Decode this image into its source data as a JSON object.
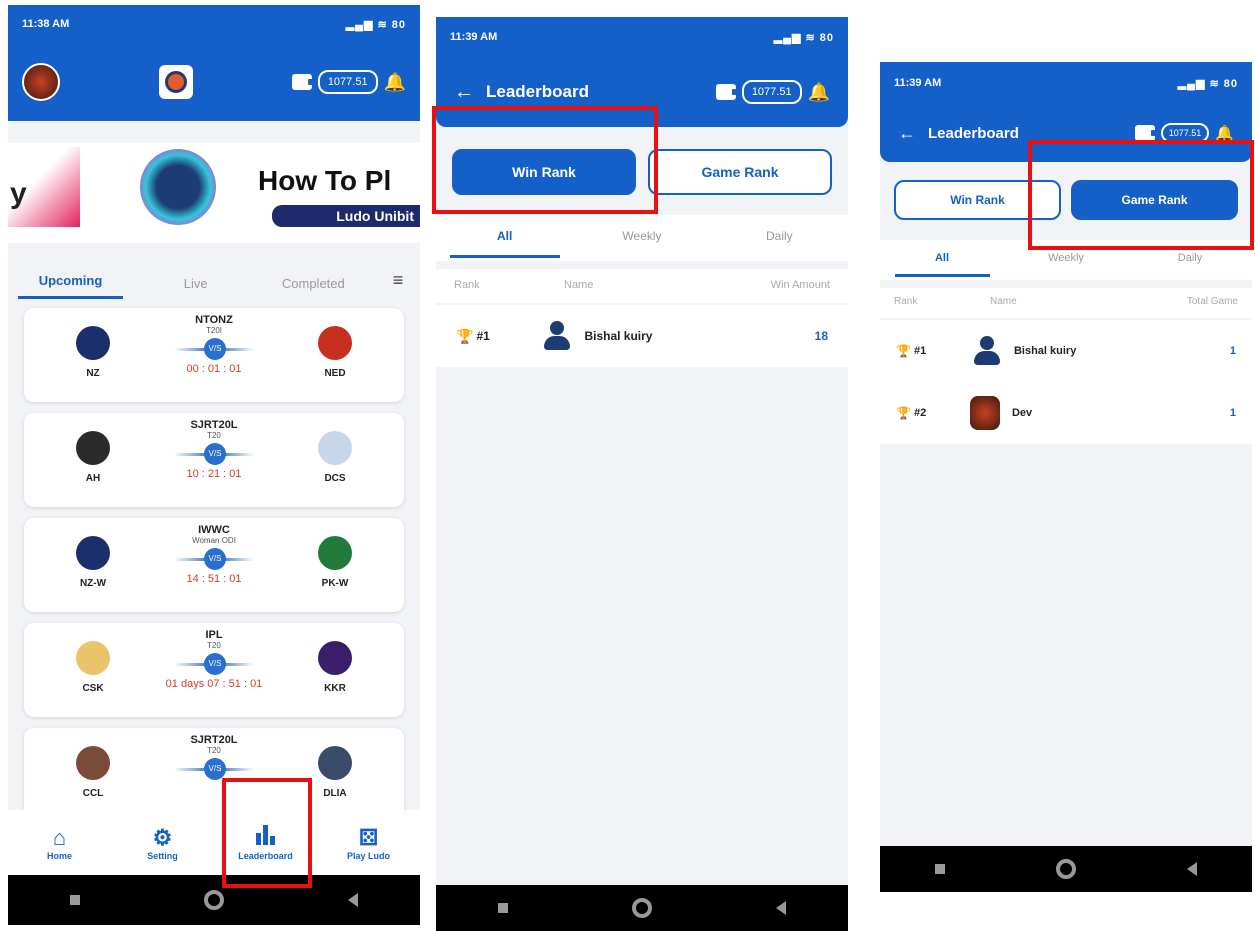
{
  "screen1": {
    "status": {
      "time": "11:38 AM",
      "icons": "▂▄▆ ≋ 80"
    },
    "balance": "1077.51",
    "banner": {
      "title": "How To Pl",
      "subtitle": "Ludo Unibit",
      "left_text": "y"
    },
    "tabs": [
      "Upcoming",
      "Live",
      "Completed"
    ],
    "matches": [
      {
        "league": "NTONZ",
        "type": "T20I",
        "team1": "NZ",
        "team2": "NED",
        "timer": "00 : 01 : 01",
        "c1": "#1a2f6b",
        "c2": "#c7301f"
      },
      {
        "league": "SJRT20L",
        "type": "T20",
        "team1": "AH",
        "team2": "DCS",
        "timer": "10 : 21 : 01",
        "c1": "#2b2b2b",
        "c2": "#c8d6ea"
      },
      {
        "league": "IWWC",
        "type": "Woman ODI",
        "team1": "NZ-W",
        "team2": "PK-W",
        "timer": "14 : 51 : 01",
        "c1": "#1a2f6b",
        "c2": "#1f7a3b"
      },
      {
        "league": "IPL",
        "type": "T20",
        "team1": "CSK",
        "team2": "KKR",
        "timer": "01 days 07 : 51 : 01",
        "c1": "#e9c46a",
        "c2": "#3b1e6b"
      },
      {
        "league": "SJRT20L",
        "type": "T20",
        "team1": "CCL",
        "team2": "DLIA",
        "timer": "",
        "c1": "#7a4a3a",
        "c2": "#3a4a6a"
      }
    ],
    "vs": "V/S",
    "bottom_nav": [
      "Home",
      "Setting",
      "Leaderboard",
      "Play Ludo"
    ]
  },
  "screen2": {
    "status": {
      "time": "11:39 AM",
      "icons": "▂▄▆ ≋ 80"
    },
    "title": "Leaderboard",
    "balance": "1077.51",
    "buttons": [
      "Win Rank",
      "Game Rank"
    ],
    "tabs": [
      "All",
      "Weekly",
      "Daily"
    ],
    "headers": [
      "Rank",
      "Name",
      "Win Amount"
    ],
    "rows": [
      {
        "rank": "#1",
        "name": "Bishal kuiry",
        "value": "18"
      }
    ]
  },
  "screen3": {
    "status": {
      "time": "11:39 AM",
      "icons": "▂▄▆ ≋ 80"
    },
    "title": "Leaderboard",
    "balance": "1077.51",
    "buttons": [
      "Win Rank",
      "Game Rank"
    ],
    "tabs": [
      "All",
      "Weekly",
      "Daily"
    ],
    "headers": [
      "Rank",
      "Name",
      "Total Game"
    ],
    "rows": [
      {
        "rank": "#1",
        "name": "Bishal kuiry",
        "value": "1"
      },
      {
        "rank": "#2",
        "name": "Dev",
        "value": "1"
      }
    ]
  },
  "icons": {
    "trophy": "🏆",
    "bell": "🔔",
    "back": "←",
    "filter": "≡",
    "home": "⌂",
    "gear": "⚙",
    "bars": "▮",
    "dice": "⚄"
  },
  "colors": {
    "primary": "#1560c8",
    "highlight": "#e81010",
    "timer": "#d23c2c"
  }
}
